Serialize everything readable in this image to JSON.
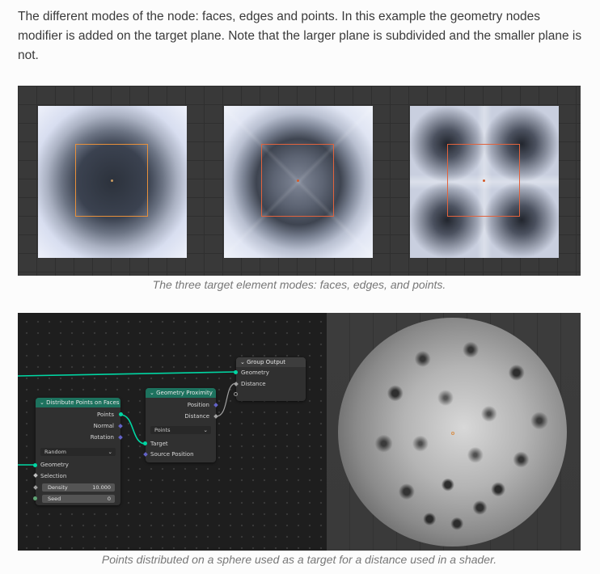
{
  "paragraph": "The different modes of the node: faces, edges and points. In this example the geometry nodes modifier is added on the target plane. Note that the larger plane is subdivided and the smaller plane is not.",
  "figure1": {
    "caption": "The three target element modes: faces, edges, and points."
  },
  "figure2": {
    "caption": "Points distributed on a sphere used as a target for a distance used in a shader.",
    "nodes": {
      "distribute": {
        "title": "Distribute Points on Faces",
        "out_points": "Points",
        "out_normal": "Normal",
        "out_rotation": "Rotation",
        "method": "Random",
        "in_geometry": "Geometry",
        "in_selection": "Selection",
        "density_label": "Density",
        "density_value": "10.000",
        "seed_label": "Seed",
        "seed_value": "0"
      },
      "proximity": {
        "title": "Geometry Proximity",
        "out_position": "Position",
        "out_distance": "Distance",
        "mode": "Points",
        "in_target": "Target",
        "in_source": "Source Position"
      },
      "group_output": {
        "title": "Group Output",
        "in_geometry": "Geometry",
        "in_distance": "Distance"
      }
    }
  },
  "colors": {
    "accent_node_header": "#1d725e",
    "geometry_wire": "#00d6a3",
    "selection_outline": "#e8903a"
  }
}
